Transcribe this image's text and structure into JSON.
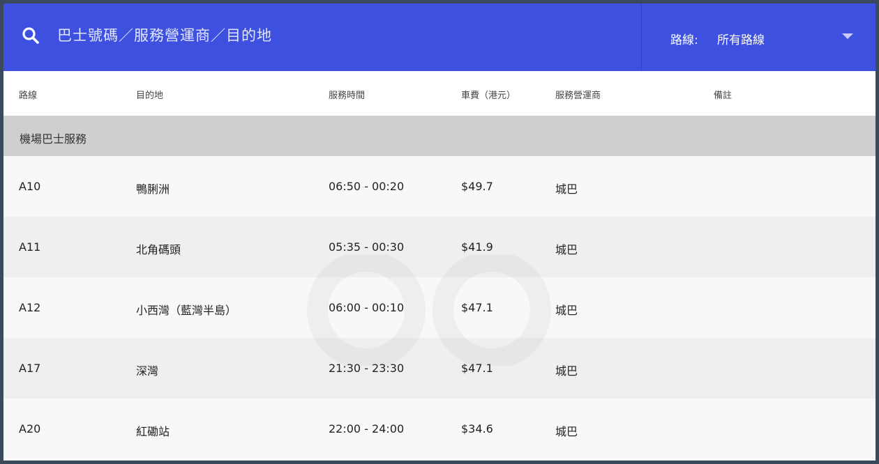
{
  "search": {
    "placeholder": "巴士號碼／服務營運商／目的地"
  },
  "route_filter": {
    "label": "路線:",
    "selected": "所有路線"
  },
  "table": {
    "headers": [
      "路線",
      "目的地",
      "服務時間",
      "車費（港元）",
      "服務營運商",
      "備註"
    ],
    "group": "機場巴士服務",
    "rows": [
      {
        "route": "A10",
        "destination": "鴨脷洲",
        "hours": "06:50 - 00:20",
        "fare": "$49.7",
        "operator": "城巴",
        "note": ""
      },
      {
        "route": "A11",
        "destination": "北角碼頭",
        "hours": "05:35 - 00:30",
        "fare": "$41.9",
        "operator": "城巴",
        "note": ""
      },
      {
        "route": "A12",
        "destination": "小西灣（藍灣半島）",
        "hours": "06:00 - 00:10",
        "fare": "$47.1",
        "operator": "城巴",
        "note": ""
      },
      {
        "route": "A17",
        "destination": "深灣",
        "hours": "21:30 - 23:30",
        "fare": "$47.1",
        "operator": "城巴",
        "note": ""
      },
      {
        "route": "A20",
        "destination": "紅磡站",
        "hours": "22:00 - 24:00",
        "fare": "$34.6",
        "operator": "城巴",
        "note": ""
      }
    ]
  },
  "colors": {
    "header_bg": "#3d50e0",
    "group_row_bg": "#cfcfcf"
  },
  "icons": {
    "search": "search-icon",
    "dropdown": "chevron-down-icon"
  }
}
